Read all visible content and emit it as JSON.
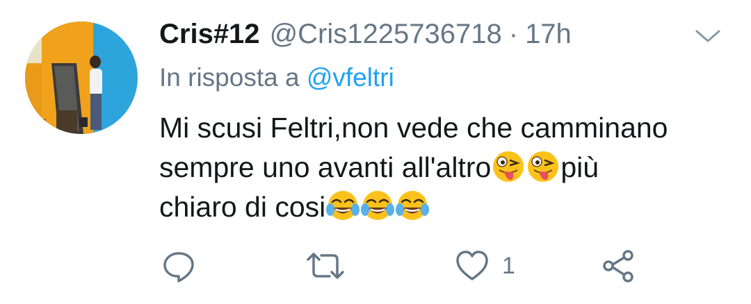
{
  "tweet": {
    "display_name": "Cris#12",
    "handle": "@Cris1225736718",
    "separator": "·",
    "time": "17h",
    "reply_prefix": "In risposta a",
    "reply_to": "@vfeltri",
    "text_line1": "Mi scusi Feltri,non vede che camminano",
    "text_line2": "sempre uno avanti all'altro",
    "text_line2_end": "più",
    "text_line3": "chiaro di cosi",
    "emojis": [
      "zany-face-emoji",
      "zany-face-emoji",
      "tears-of-joy-emoji",
      "tears-of-joy-emoji",
      "tears-of-joy-emoji"
    ]
  },
  "actions": {
    "reply_icon": "reply-icon",
    "retweet_icon": "retweet-icon",
    "like_icon": "heart-icon",
    "like_count": "1",
    "share_icon": "share-icon"
  },
  "colors": {
    "text": "#14171a",
    "secondary": "#657786",
    "link": "#1da1f2",
    "avatar_orange": "#f0a21c",
    "avatar_blue": "#2ea4dc"
  }
}
